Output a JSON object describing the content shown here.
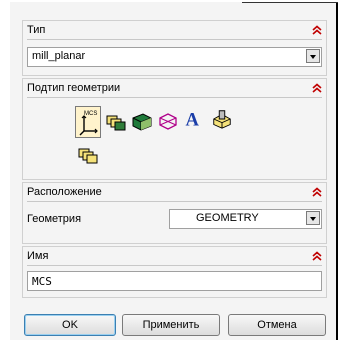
{
  "sections": {
    "type": {
      "title": "Тип",
      "value": "mill_planar"
    },
    "geometry_subtype": {
      "title": "Подтип геометрии",
      "icons": [
        "mcs-icon",
        "workpiece-icon",
        "mill-area-icon",
        "mill-boundary-icon",
        "mill-text-icon",
        "mill-geom-icon",
        "mill-bnd-icon"
      ]
    },
    "location": {
      "title": "Расположение",
      "geometry_label": "Геометрия",
      "geometry_value": "GEOMETRY"
    },
    "name": {
      "title": "Имя",
      "value": "MCS"
    }
  },
  "buttons": {
    "ok": "OK",
    "apply": "Применить",
    "cancel": "Отмена"
  },
  "colors": {
    "collapse_chevron": "#c00000",
    "default_button_border": "#3c7fb1"
  }
}
